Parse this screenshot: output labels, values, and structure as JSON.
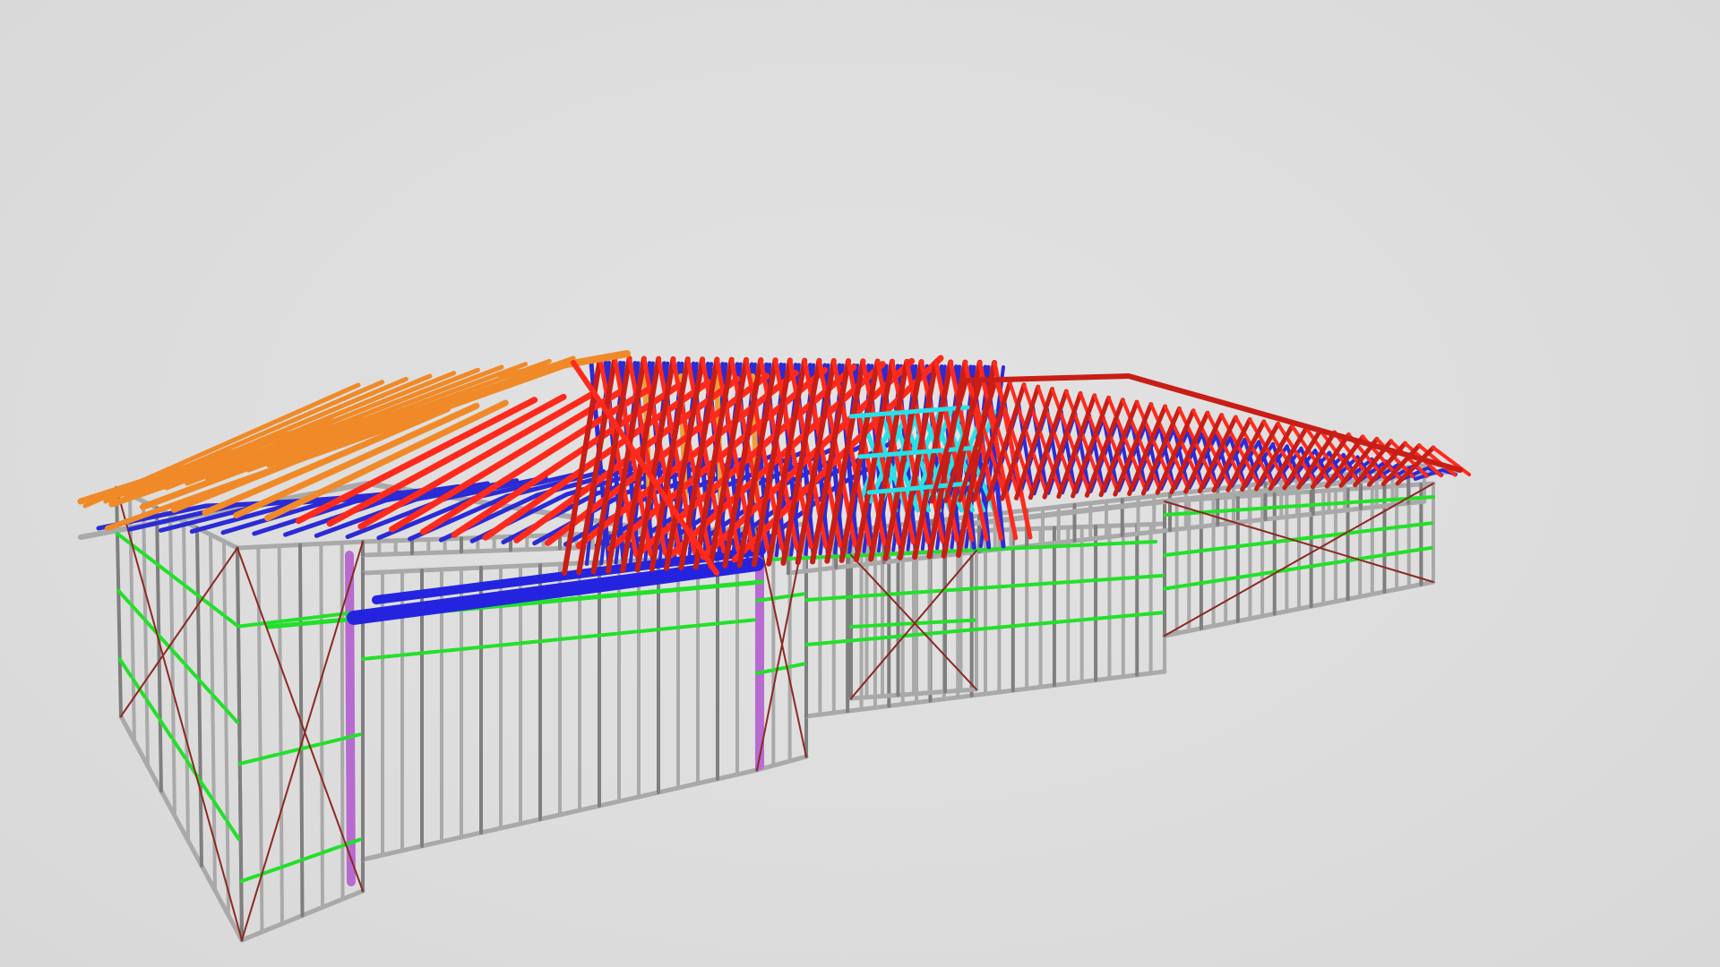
{
  "viewer": {
    "background": "#dddddd"
  },
  "model": {
    "description_icon": "steel-frame-house-3d-model",
    "colors": {
      "wall_frame": "#a9a9a9",
      "wall_frame_dark": "#7f7f7f",
      "nogging": "#22e02a",
      "diagonal_brace": "#8a2a22",
      "truss_chord_red": "#ff2a1c",
      "truss_chord_darkred": "#c81e16",
      "truss_chord_orange": "#f08a28",
      "truss_web_blue": "#2b2bd6",
      "truss_web_cyan": "#28e0e8",
      "lintel_blue": "#2424e0",
      "post_violet": "#b76ad0",
      "timber_yellow": "#e8a23a"
    }
  }
}
